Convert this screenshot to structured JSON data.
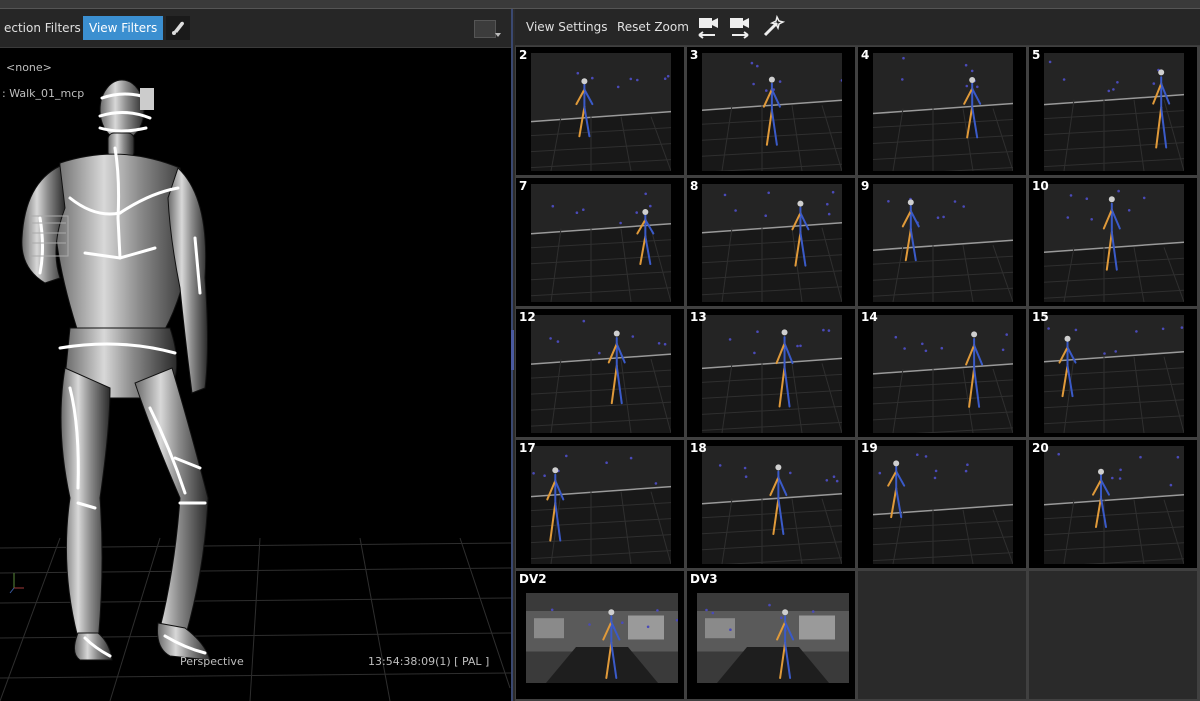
{
  "left_toolbar": {
    "selection_filters_label": "ection Filters",
    "view_filters_label": "View Filters"
  },
  "viewport": {
    "subject_label": "<none>",
    "take_label": ": Walk_01_mcp",
    "view_mode": "Perspective",
    "timecode": "13:54:38:09(1) [ PAL ]"
  },
  "right_toolbar": {
    "view_settings_label": "View Settings",
    "reset_zoom_label": "Reset Zoom",
    "icons": [
      "camera-prev-icon",
      "camera-next-icon",
      "wand-icon"
    ]
  },
  "cameras": [
    {
      "label": "2"
    },
    {
      "label": "3"
    },
    {
      "label": "4"
    },
    {
      "label": "5"
    },
    {
      "label": "7"
    },
    {
      "label": "8"
    },
    {
      "label": "9"
    },
    {
      "label": "10"
    },
    {
      "label": "12"
    },
    {
      "label": "13"
    },
    {
      "label": "14"
    },
    {
      "label": "15"
    },
    {
      "label": "17"
    },
    {
      "label": "18"
    },
    {
      "label": "19"
    },
    {
      "label": "20"
    },
    {
      "label": "DV2"
    },
    {
      "label": "DV3"
    },
    {
      "label": ""
    },
    {
      "label": ""
    }
  ],
  "colors": {
    "accent": "#3b8fd0",
    "marker": "#4a4ab8",
    "skeleton_orange": "#e09a3a",
    "skeleton_blue": "#3a5ac8"
  }
}
